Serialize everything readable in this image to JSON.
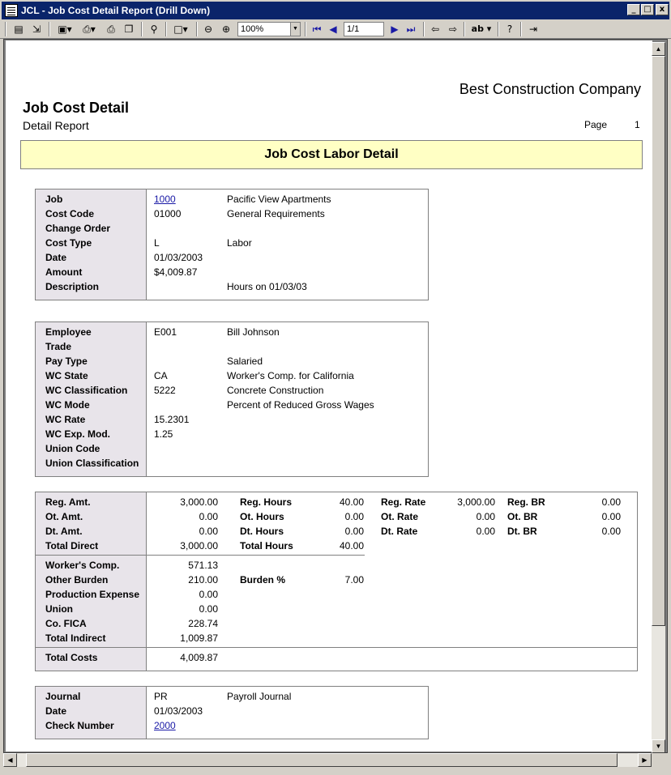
{
  "window": {
    "title": "JCL - Job Cost Detail Report (Drill Down)",
    "min_btn": "_",
    "max_btn": "□",
    "close_btn": "x"
  },
  "toolbar": {
    "zoom_value": "100%",
    "page_value": "1/1",
    "find_label": "ab"
  },
  "report": {
    "company": "Best Construction Company",
    "title": "Job Cost Detail",
    "subtitle": "Detail Report",
    "page_label": "Page",
    "page_number": "1",
    "banner": "Job Cost Labor Detail"
  },
  "job_section": {
    "rows": [
      {
        "label": "Job",
        "value": "1000",
        "desc": "Pacific View Apartments"
      },
      {
        "label": "Cost Code",
        "value": "01000",
        "desc": "General Requirements"
      },
      {
        "label": "Change Order",
        "value": "",
        "desc": ""
      },
      {
        "label": "Cost Type",
        "value": "L",
        "desc": "Labor"
      },
      {
        "label": "Date",
        "value": "01/03/2003",
        "desc": ""
      },
      {
        "label": "Amount",
        "value": "$4,009.87",
        "desc": ""
      },
      {
        "label": "Description",
        "value": "",
        "desc": "Hours on 01/03/03"
      }
    ]
  },
  "employee_section": {
    "rows": [
      {
        "label": "Employee",
        "value": "E001",
        "desc": "Bill Johnson"
      },
      {
        "label": "Trade",
        "value": "",
        "desc": ""
      },
      {
        "label": "Pay Type",
        "value": "",
        "desc": "Salaried"
      },
      {
        "label": "WC State",
        "value": "CA",
        "desc": "Worker's Comp. for California"
      },
      {
        "label": "WC Classification",
        "value": "5222",
        "desc": "Concrete Construction"
      },
      {
        "label": "WC Mode",
        "value": "",
        "desc": "Percent of Reduced Gross Wages"
      },
      {
        "label": "WC Rate",
        "value": "15.2301",
        "desc": ""
      },
      {
        "label": "WC Exp. Mod.",
        "value": "1.25",
        "desc": ""
      },
      {
        "label": "Union Code",
        "value": "",
        "desc": ""
      },
      {
        "label": "Union Classification",
        "value": "",
        "desc": ""
      }
    ]
  },
  "costs_section": {
    "direct": [
      {
        "label": "Reg. Amt.",
        "value": "3,000.00",
        "h_label": "Reg. Hours",
        "h_value": "40.00",
        "r_label": "Reg. Rate",
        "r_value": "3,000.00",
        "br_label": "Reg. BR",
        "br_value": "0.00"
      },
      {
        "label": "Ot. Amt.",
        "value": "0.00",
        "h_label": "Ot. Hours",
        "h_value": "0.00",
        "r_label": "Ot. Rate",
        "r_value": "0.00",
        "br_label": "Ot. BR",
        "br_value": "0.00"
      },
      {
        "label": "Dt. Amt.",
        "value": "0.00",
        "h_label": "Dt. Hours",
        "h_value": "0.00",
        "r_label": "Dt. Rate",
        "r_value": "0.00",
        "br_label": "Dt. BR",
        "br_value": "0.00"
      },
      {
        "label": "Total Direct",
        "value": "3,000.00",
        "h_label": "Total Hours",
        "h_value": "40.00",
        "r_label": "",
        "r_value": "",
        "br_label": "",
        "br_value": ""
      }
    ],
    "indirect": [
      {
        "label": "Worker's Comp.",
        "value": "571.13",
        "x_label": "",
        "x_value": ""
      },
      {
        "label": "Other Burden",
        "value": "210.00",
        "x_label": "Burden %",
        "x_value": "7.00"
      },
      {
        "label": "Production Expense",
        "value": "0.00",
        "x_label": "",
        "x_value": ""
      },
      {
        "label": "Union",
        "value": "0.00",
        "x_label": "",
        "x_value": ""
      },
      {
        "label": "Co. FICA",
        "value": "228.74",
        "x_label": "",
        "x_value": ""
      },
      {
        "label": "Total Indirect",
        "value": "1,009.87",
        "x_label": "",
        "x_value": ""
      }
    ],
    "total": {
      "label": "Total Costs",
      "value": "4,009.87"
    }
  },
  "journal_section": {
    "rows": [
      {
        "label": "Journal",
        "value": "PR",
        "desc": "Payroll Journal"
      },
      {
        "label": "Date",
        "value": "01/03/2003",
        "desc": ""
      },
      {
        "label": "Check Number",
        "value": "2000",
        "desc": ""
      }
    ]
  }
}
